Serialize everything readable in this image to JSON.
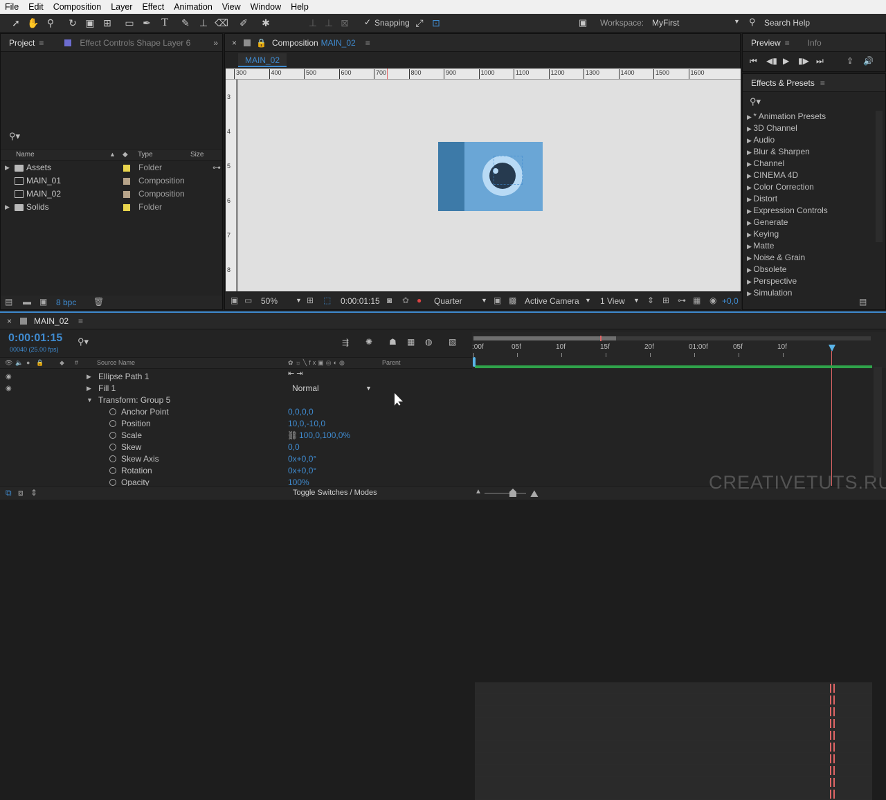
{
  "menu": [
    "File",
    "Edit",
    "Composition",
    "Layer",
    "Effect",
    "Animation",
    "View",
    "Window",
    "Help"
  ],
  "toolbar": {
    "snapping_label": "Snapping",
    "workspace_label": "Workspace:",
    "workspace_value": "MyFirst",
    "search_help": "Search Help"
  },
  "project": {
    "tab_project": "Project",
    "tab_effect_controls": "Effect Controls Shape Layer 6",
    "search_placeholder": "",
    "col_name": "Name",
    "col_type": "Type",
    "col_size": "Size",
    "items": [
      {
        "name": "Assets",
        "type": "Folder",
        "kind": "folder",
        "color": "#e8d44d"
      },
      {
        "name": "MAIN_01",
        "type": "Composition",
        "kind": "comp",
        "color": "#b7a48a"
      },
      {
        "name": "MAIN_02",
        "type": "Composition",
        "kind": "comp",
        "color": "#b7a48a"
      },
      {
        "name": "Solids",
        "type": "Folder",
        "kind": "folder",
        "color": "#e8d44d"
      }
    ],
    "bpc": "8 bpc"
  },
  "composition": {
    "tab_label": "Composition",
    "tab_name": "MAIN_02",
    "sub_tab": "MAIN_02",
    "ruler_marks": [
      "300",
      "400",
      "500",
      "600",
      "700",
      "800",
      "900",
      "1000",
      "1100",
      "1200",
      "1300",
      "1400",
      "1500",
      "1600"
    ],
    "vruler_marks": [
      "3",
      "4",
      "5",
      "6",
      "7",
      "8"
    ],
    "zoom": "50%",
    "timecode": "0:00:01:15",
    "resolution": "Quarter",
    "camera": "Active Camera",
    "views": "1 View",
    "exposure": "+0,0"
  },
  "preview": {
    "tab_preview": "Preview",
    "tab_info": "Info"
  },
  "effects": {
    "title": "Effects & Presets",
    "items": [
      "* Animation Presets",
      "3D Channel",
      "Audio",
      "Blur & Sharpen",
      "Channel",
      "CINEMA 4D",
      "Color Correction",
      "Distort",
      "Expression Controls",
      "Generate",
      "Keying",
      "Matte",
      "Noise & Grain",
      "Obsolete",
      "Perspective",
      "Simulation"
    ]
  },
  "timeline": {
    "tab_name": "MAIN_02",
    "timecode": "0:00:01:15",
    "frames_fps": "00040 (25.00 fps)",
    "col_source": "Source Name",
    "col_parent": "Parent",
    "ruler": [
      ":00f",
      "05f",
      "10f",
      "15f",
      "20f",
      "01:00f",
      "05f",
      "10f"
    ],
    "layers": [
      {
        "label": "Ellipse Path 1",
        "indent": 1,
        "arrow": "right",
        "value": "",
        "stopwatch": false
      },
      {
        "label": "Fill 1",
        "indent": 1,
        "arrow": "right",
        "value": "Normal",
        "stopwatch": false
      },
      {
        "label": "Transform: Group 5",
        "indent": 1,
        "arrow": "down",
        "value": "",
        "stopwatch": false
      },
      {
        "label": "Anchor Point",
        "indent": 2,
        "arrow": "",
        "value": "0,0,0,0",
        "stopwatch": true
      },
      {
        "label": "Position",
        "indent": 2,
        "arrow": "",
        "value": "10,0,-10,0",
        "stopwatch": true
      },
      {
        "label": "Scale",
        "indent": 2,
        "arrow": "",
        "value": "100,0,100,0%",
        "stopwatch": true
      },
      {
        "label": "Skew",
        "indent": 2,
        "arrow": "",
        "value": "0,0",
        "stopwatch": true
      },
      {
        "label": "Skew Axis",
        "indent": 2,
        "arrow": "",
        "value": "0x+0,0°",
        "stopwatch": true
      },
      {
        "label": "Rotation",
        "indent": 2,
        "arrow": "",
        "value": "0x+0,0°",
        "stopwatch": true
      },
      {
        "label": "Opacity",
        "indent": 2,
        "arrow": "",
        "value": "100%",
        "stopwatch": true
      }
    ],
    "toggle_label": "Toggle Switches / Modes"
  },
  "watermark": "CREATIVETUTS.RU",
  "colors": {
    "accent": "#3f8bd0",
    "camera_body": "#6aa6d6",
    "camera_dark": "#3d7aa8",
    "canvas_bg": "#e0e0e0",
    "keyframe": "#e06666",
    "work_bar": "#2fa34a"
  }
}
